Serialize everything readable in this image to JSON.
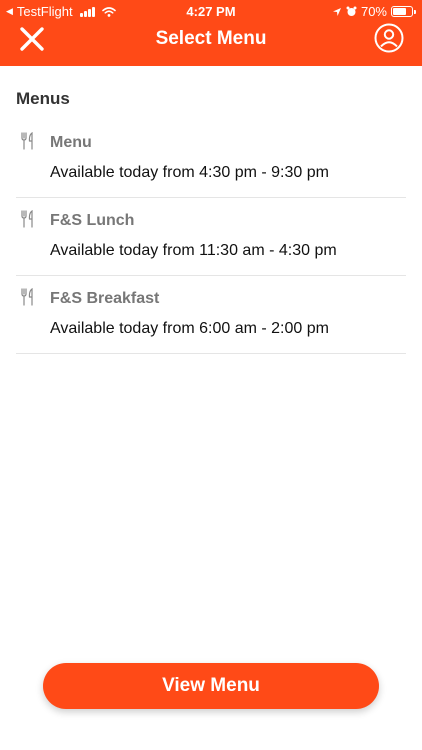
{
  "status_bar": {
    "carrier": "TestFlight",
    "time": "4:27 PM",
    "battery_text": "70%",
    "battery_level": 0.7
  },
  "header": {
    "title": "Select Menu",
    "close_icon": "close-icon",
    "profile_icon": "user-circle-icon",
    "color": "#ff4a17"
  },
  "section_title": "Menus",
  "menus": [
    {
      "name": "Menu",
      "availability": "Available today from 4:30 pm - 9:30 pm"
    },
    {
      "name": "F&S Lunch",
      "availability": "Available today from 11:30 am - 4:30 pm"
    },
    {
      "name": "F&S Breakfast",
      "availability": "Available today from 6:00 am - 2:00 pm"
    }
  ],
  "view_button_label": "View Menu"
}
